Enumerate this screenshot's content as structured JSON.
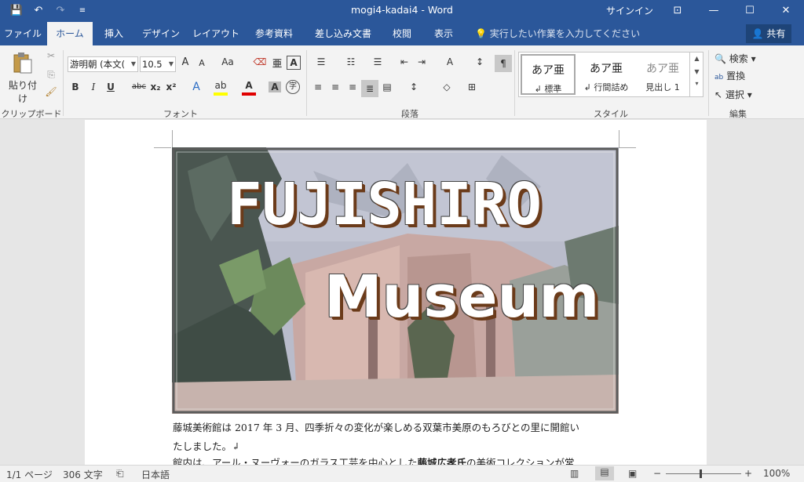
{
  "titlebar": {
    "title": "mogi4-kadai4  -  Word",
    "signin": "サインイン",
    "save_icon": "💾",
    "undo_icon": "↶",
    "redo_icon": "↷",
    "customize_icon": "≡",
    "ribbon_display_icon": "⊡",
    "minimize_icon": "—",
    "maximize_icon": "☐",
    "close_icon": "✕"
  },
  "tabs": [
    "ファイル",
    "ホーム",
    "挿入",
    "デザイン",
    "レイアウト",
    "参考資料",
    "差し込み文書",
    "校閲",
    "表示"
  ],
  "tellme": "実行したい作業を入力してください",
  "share": "共有",
  "ribbon": {
    "clipboard": {
      "paste_label": "貼り付け",
      "group": "クリップボード"
    },
    "font": {
      "font_name": "游明朝 (本文(",
      "font_size": "10.5",
      "group": "フォント",
      "grow": "A",
      "shrink": "A",
      "case": "Aa",
      "bold": "B",
      "italic": "I",
      "underline": "U",
      "strike": "abc",
      "subscript": "x₂",
      "superscript": "x²"
    },
    "paragraph": {
      "group": "段落"
    },
    "styles": {
      "group": "スタイル",
      "items": [
        {
          "sample": "あア亜",
          "name": "↲ 標準"
        },
        {
          "sample": "あア亜",
          "name": "↲ 行間詰め"
        },
        {
          "sample": "あア亜",
          "name": "見出し 1"
        }
      ]
    },
    "editing": {
      "group": "編集",
      "find": "検索",
      "replace": "置換",
      "select": "選択"
    }
  },
  "document": {
    "banner_title": "FUJISHIRO",
    "banner_subtitle": "Museum",
    "para1_line1": "藤城美術館は 2017 年 3 月、四季折々の変化が楽しめる双葉市美原のもろびとの里に開館い",
    "para1_line2": "たしました。↲",
    "para2_start": "館内は、アール・ヌーヴォーのガラス工芸を中心とした",
    "para2_bold": "藤城広孝氏",
    "para2_end": "の美術コレクションが常"
  },
  "status": {
    "page": "1/1 ページ",
    "words": "306 文字",
    "lang": "日本語",
    "zoom": "100%",
    "zoom_minus": "−",
    "zoom_plus": "+"
  }
}
